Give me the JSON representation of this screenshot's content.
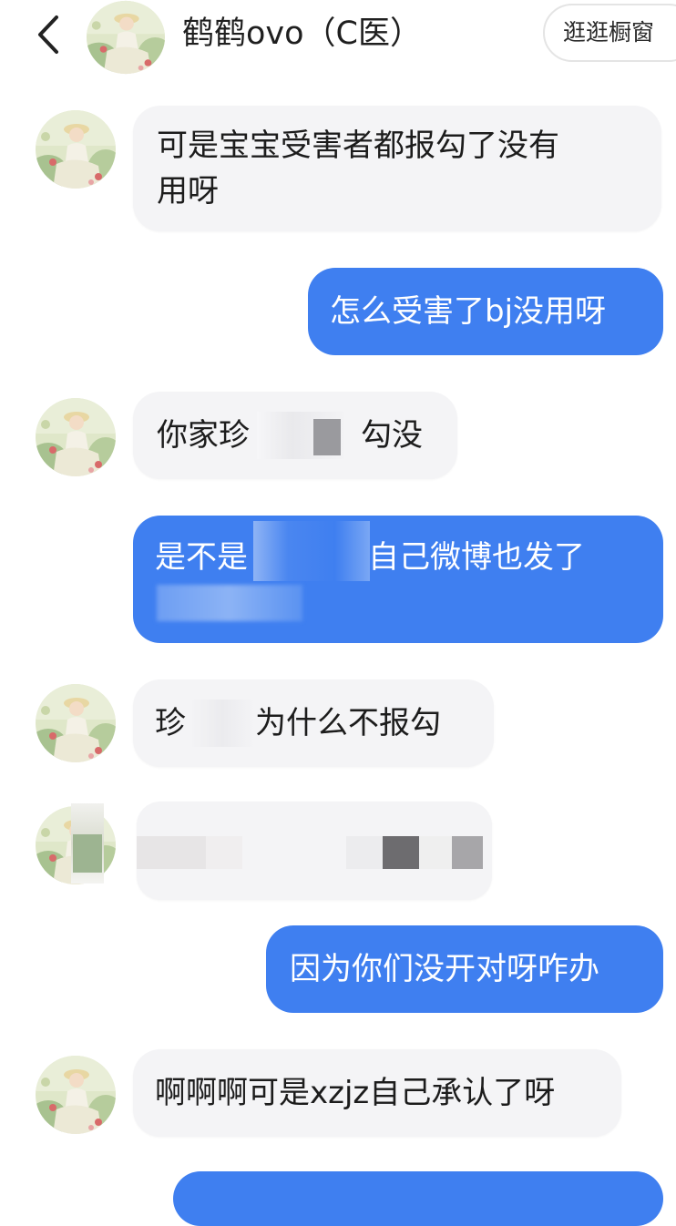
{
  "header": {
    "back_icon": "chevron-left-icon",
    "title": "鹤鹤ovo（C医）",
    "shop_button": "逛逛橱窗"
  },
  "messages": [
    {
      "direction": "incoming",
      "line1": "可是宝宝受害者都报勾了没有",
      "line2": "用呀"
    },
    {
      "direction": "outgoing",
      "text": "怎么受害了bj没用呀"
    },
    {
      "direction": "incoming",
      "text_before": "你家珍",
      "text_after": "勾没",
      "partially_redacted": true
    },
    {
      "direction": "outgoing",
      "text_before": "是不是",
      "text_after": "自己微博也发了",
      "partially_redacted": true
    },
    {
      "direction": "incoming",
      "text_before": "珍",
      "text_after": "为什么不报勾",
      "partially_redacted": true
    },
    {
      "direction": "incoming",
      "redacted": true
    },
    {
      "direction": "outgoing",
      "text": "因为你们没开对呀咋办"
    },
    {
      "direction": "incoming",
      "text": "啊啊啊可是xzjz自己承认了呀"
    },
    {
      "direction": "outgoing",
      "cut_off": true
    }
  ],
  "colors": {
    "outgoing_bubble": "#3f7ff0",
    "incoming_bubble": "#f4f4f6",
    "background": "#ffffff"
  }
}
